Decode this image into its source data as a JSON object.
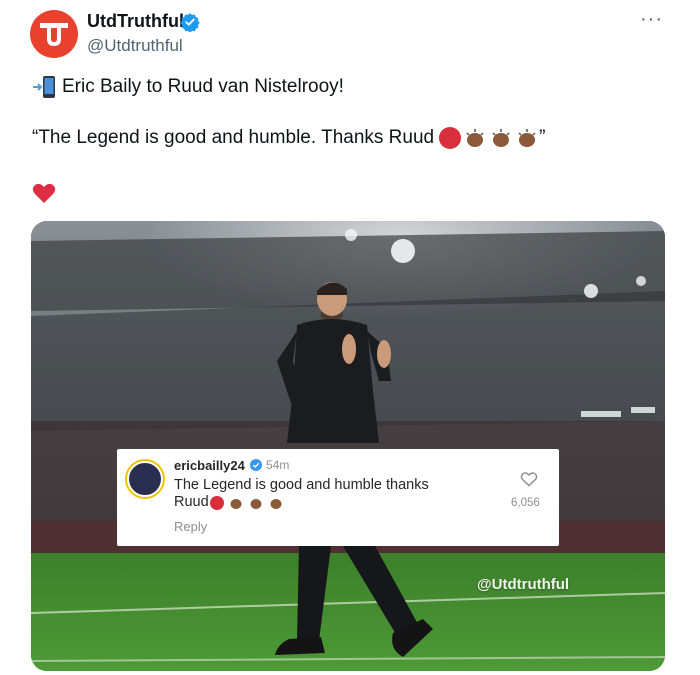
{
  "author": {
    "display_name": "UtdTruthful",
    "handle": "@Utdtruthful",
    "verified": true,
    "avatar_icon": "utd-logo-icon"
  },
  "more_label": "···",
  "tweet": {
    "line1_icon": "mobile-phone-arrow-icon",
    "line1": "Eric Baily to Ruud van Nistelrooy!",
    "line2_quote": "“The Legend is good and humble. Thanks Ruud",
    "line2_close": "”",
    "line2_emojis": [
      "red-circle-icon",
      "clap-icon",
      "clap-icon",
      "clap-icon"
    ],
    "line3_icon": "red-heart-icon"
  },
  "media": {
    "description_icon": "stadium-photo",
    "instagram_comment": {
      "username": "ericbailly24",
      "time": "54m",
      "text_line1": "The Legend is good and humble thanks",
      "text_line2": "Ruud",
      "reply_label": "Reply",
      "like_count": "6,056"
    },
    "watermark": "@Utdtruthful"
  },
  "colors": {
    "brand_red": "#e8412e",
    "verified_blue": "#1d9bf0",
    "pitch_green": "#3f8a2f"
  }
}
